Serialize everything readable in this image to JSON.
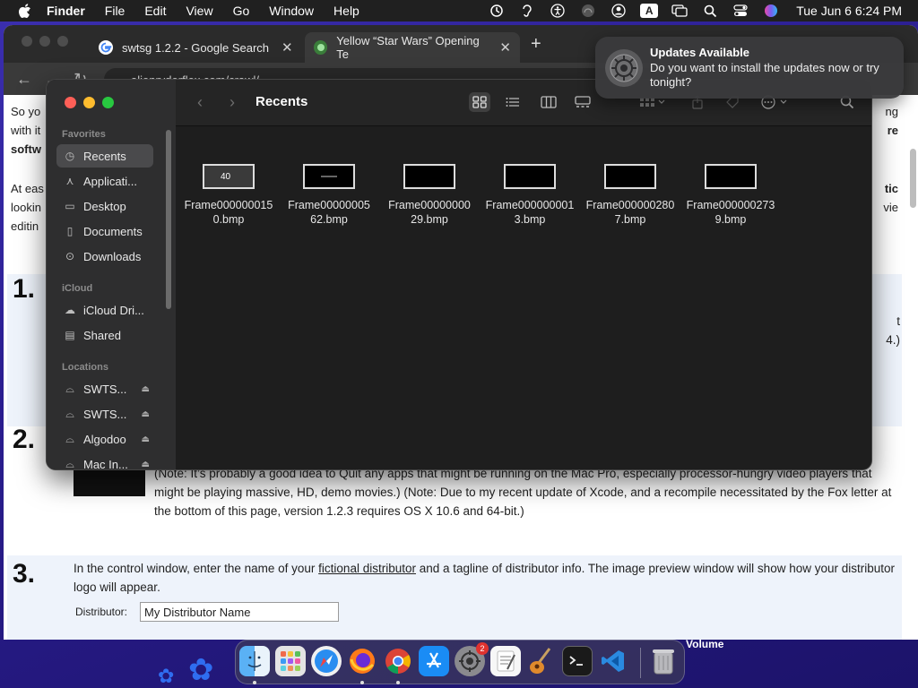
{
  "menubar": {
    "app_name": "Finder",
    "menus": [
      "File",
      "Edit",
      "View",
      "Go",
      "Window",
      "Help"
    ],
    "input_source": "A",
    "clock": "Tue Jun 6  6:24 PM"
  },
  "browser": {
    "tabs": [
      {
        "title": "swtsg 1.2.2 - Google Search"
      },
      {
        "title": "Yellow “Star Wars” Opening Te"
      }
    ],
    "url": "alienryderflex.com/crawl/",
    "page": {
      "para1_line1": "So yo",
      "para1_line2": "with it",
      "para1_line3": "softw",
      "para1_right1": "ng",
      "para1_right2": "re",
      "para2_line1": "At eas",
      "para2_line2": "lookin",
      "para2_line3": "editin",
      "para2_right1": "tic",
      "para2_right2": "vie",
      "step1_num": "1.",
      "step1_right1": "t",
      "step1_right2": "4.)",
      "step2_num": "2.",
      "step2_text": "(Note: It’s probably a good idea to Quit any apps that might be running on the Mac Pro, especially processor-hungry video players that might be playing massive, HD, demo movies.) (Note: Due to my recent update of Xcode, and a recompile necessitated by the Fox letter at the bottom of this page, version 1.2.3 requires OS X 10.6 and 64-bit.)",
      "step3_num": "3.",
      "step3_text_a": "In the control window, enter the name of your ",
      "step3_link": "fictional distributor",
      "step3_text_b": " and a tagline of distributor info. The image preview window will show how your distributor logo will appear.",
      "distributor_label": "Distributor:",
      "distributor_value": "My Distributor Name"
    }
  },
  "finder": {
    "title": "Recents",
    "sidebar": {
      "favorites_heading": "Favorites",
      "favorites": [
        {
          "label": "Recents",
          "icon": "clock-icon"
        },
        {
          "label": "Applicati...",
          "icon": "applications-icon"
        },
        {
          "label": "Desktop",
          "icon": "desktop-icon"
        },
        {
          "label": "Documents",
          "icon": "document-icon"
        },
        {
          "label": "Downloads",
          "icon": "download-icon"
        }
      ],
      "icloud_heading": "iCloud",
      "icloud": [
        {
          "label": "iCloud Dri...",
          "icon": "cloud-icon"
        },
        {
          "label": "Shared",
          "icon": "shared-folder-icon"
        }
      ],
      "locations_heading": "Locations",
      "locations": [
        {
          "label": "SWTS...",
          "icon": "drive-icon"
        },
        {
          "label": "SWTS...",
          "icon": "drive-icon"
        },
        {
          "label": "Algodoo",
          "icon": "drive-icon"
        },
        {
          "label": "Mac In...",
          "icon": "drive-icon"
        }
      ]
    },
    "files": [
      {
        "line1": "Frame000000015",
        "line2": "0.bmp"
      },
      {
        "line1": "Frame00000005",
        "line2": "62.bmp"
      },
      {
        "line1": "Frame00000000",
        "line2": "29.bmp"
      },
      {
        "line1": "Frame000000001",
        "line2": "3.bmp"
      },
      {
        "line1": "Frame000000280",
        "line2": "7.bmp"
      },
      {
        "line1": "Frame000000273",
        "line2": "9.bmp"
      }
    ]
  },
  "notification": {
    "title": "Updates Available",
    "body": "Do you want to install the updates now or try tonight?"
  },
  "dock": {
    "apps": [
      "finder-icon",
      "launchpad-icon",
      "safari-icon",
      "firefox-icon",
      "chrome-icon",
      "app-store-icon",
      "system-settings-icon",
      "textedit-icon",
      "garageband-icon",
      "terminal-icon",
      "vscode-icon",
      "trash-icon"
    ],
    "settings_badge": "2"
  },
  "desktop": {
    "volume_label": "Volume"
  }
}
